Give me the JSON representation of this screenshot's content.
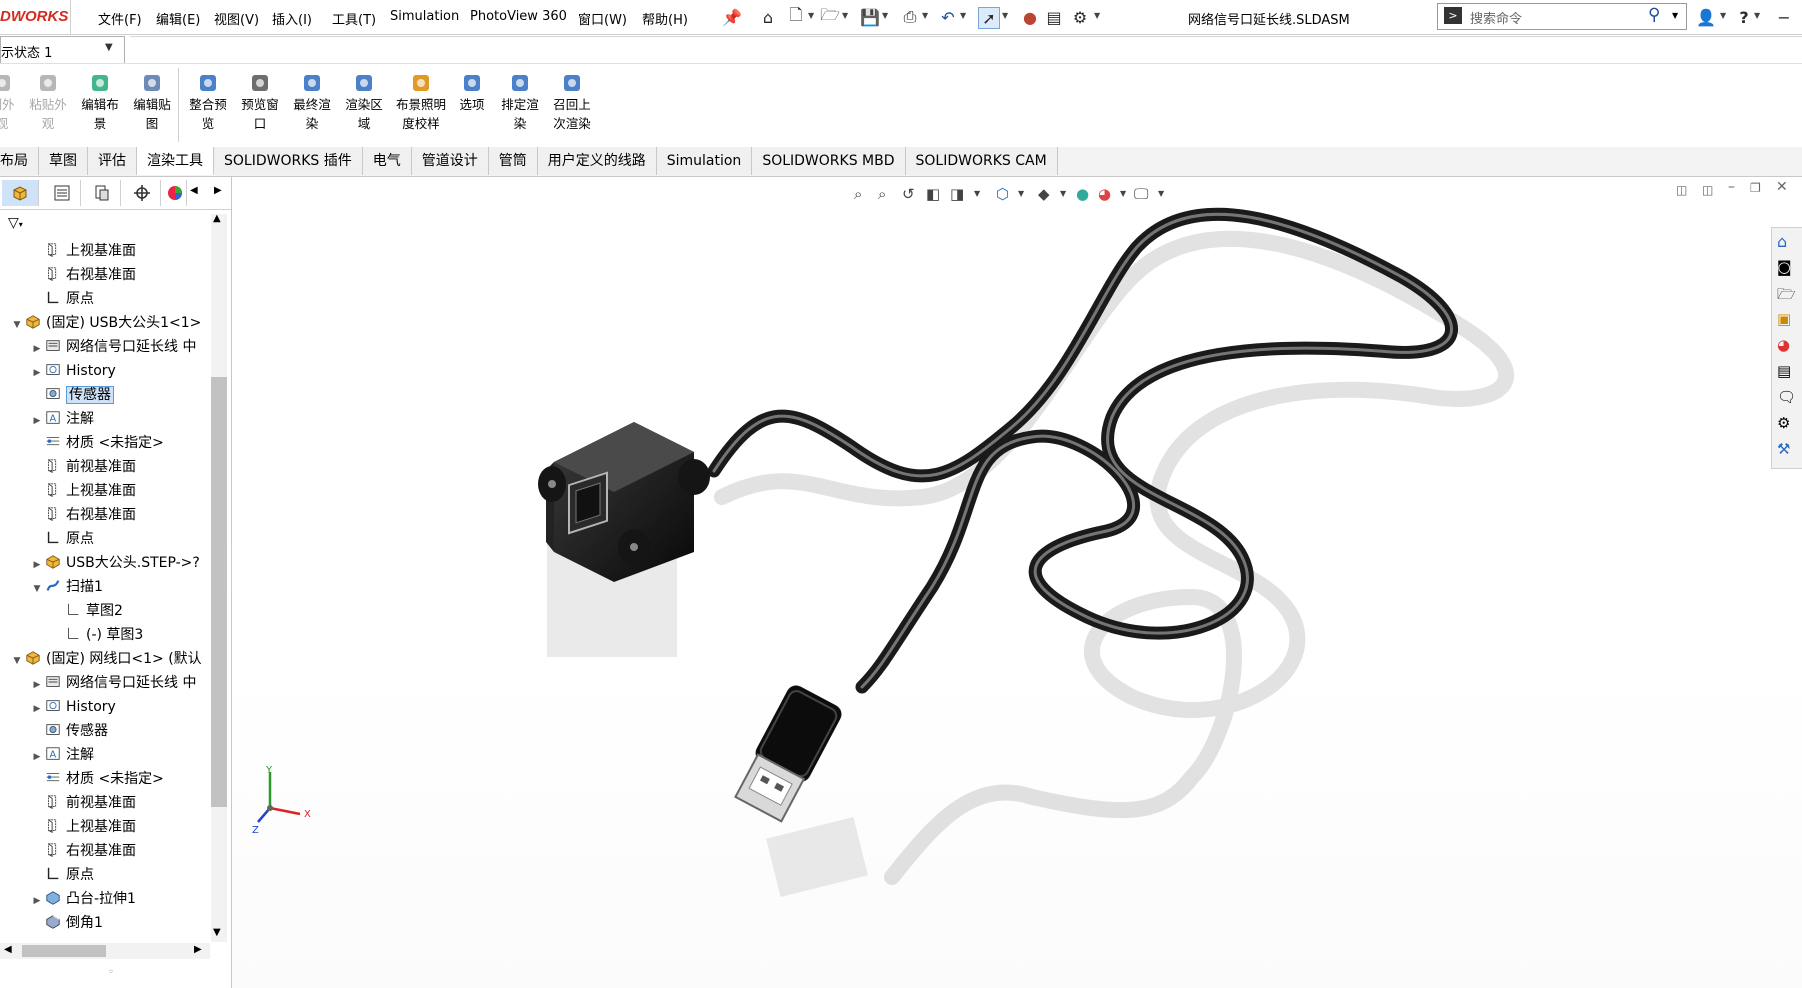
{
  "app": {
    "logo_text": "DWORKS"
  },
  "menubar": {
    "items": [
      "文件(F)",
      "编辑(E)",
      "视图(V)",
      "插入(I)",
      "工具(T)",
      "Simulation",
      "PhotoView 360",
      "窗口(W)",
      "帮助(H)"
    ]
  },
  "title": {
    "filename": "网络信号口延长线.SLDASM"
  },
  "search": {
    "placeholder": "搜索命令"
  },
  "config": {
    "value": "示状态 1"
  },
  "ribbon": {
    "buttons": [
      {
        "label": "制外\n观",
        "disabled": true
      },
      {
        "label": "粘贴外\n观",
        "disabled": true
      },
      {
        "label": "编辑布\n景",
        "disabled": false
      },
      {
        "label": "编辑贴\n图",
        "disabled": false
      },
      {
        "label": "整合预\n览",
        "disabled": false
      },
      {
        "label": "预览窗\n口",
        "disabled": false
      },
      {
        "label": "最终渲\n染",
        "disabled": false
      },
      {
        "label": "渲染区\n域",
        "disabled": false
      },
      {
        "label": "布景照明\n度校样",
        "disabled": false
      },
      {
        "label": "选项",
        "disabled": false
      },
      {
        "label": "排定渲\n染",
        "disabled": false
      },
      {
        "label": "召回上\n次渲染",
        "disabled": false
      }
    ]
  },
  "tabs": [
    "布局",
    "草图",
    "评估",
    "渲染工具",
    "SOLIDWORKS 插件",
    "电气",
    "管道设计",
    "管筒",
    "用户定义的线路",
    "Simulation",
    "SOLIDWORKS MBD",
    "SOLIDWORKS CAM"
  ],
  "active_tab": "渲染工具",
  "tree": [
    {
      "label": "上视基准面",
      "indent": 1,
      "icon": "plane-icon",
      "arrow": ""
    },
    {
      "label": "右视基准面",
      "indent": 1,
      "icon": "plane-icon",
      "arrow": ""
    },
    {
      "label": "原点",
      "indent": 1,
      "icon": "origin-icon",
      "arrow": ""
    },
    {
      "label": "(固定) USB大公头1<1>",
      "indent": 0,
      "icon": "part-icon",
      "arrow": "expanded"
    },
    {
      "label": "网络信号口延长线 中",
      "indent": 1,
      "icon": "assembly-icon",
      "arrow": "collapsed"
    },
    {
      "label": "History",
      "indent": 1,
      "icon": "history-icon",
      "arrow": "collapsed"
    },
    {
      "label": "传感器",
      "indent": 1,
      "icon": "sensor-icon",
      "arrow": "",
      "selected": true
    },
    {
      "label": "注解",
      "indent": 1,
      "icon": "annotation-icon",
      "arrow": "collapsed"
    },
    {
      "label": "材质 <未指定>",
      "indent": 1,
      "icon": "material-icon",
      "arrow": ""
    },
    {
      "label": "前视基准面",
      "indent": 1,
      "icon": "plane-icon",
      "arrow": ""
    },
    {
      "label": "上视基准面",
      "indent": 1,
      "icon": "plane-icon",
      "arrow": ""
    },
    {
      "label": "右视基准面",
      "indent": 1,
      "icon": "plane-icon",
      "arrow": ""
    },
    {
      "label": "原点",
      "indent": 1,
      "icon": "origin-icon",
      "arrow": ""
    },
    {
      "label": "USB大公头.STEP->?",
      "indent": 1,
      "icon": "part-icon",
      "arrow": "collapsed"
    },
    {
      "label": "扫描1",
      "indent": 1,
      "icon": "sweep-icon",
      "arrow": "expanded"
    },
    {
      "label": "草图2",
      "indent": 2,
      "icon": "sketch-icon",
      "arrow": ""
    },
    {
      "label": "(-) 草图3",
      "indent": 2,
      "icon": "sketch-icon",
      "arrow": ""
    },
    {
      "label": "(固定) 网线口<1> (默认",
      "indent": 0,
      "icon": "part-icon",
      "arrow": "expanded"
    },
    {
      "label": "网络信号口延长线 中",
      "indent": 1,
      "icon": "assembly-icon",
      "arrow": "collapsed"
    },
    {
      "label": "History",
      "indent": 1,
      "icon": "history-icon",
      "arrow": "collapsed"
    },
    {
      "label": "传感器",
      "indent": 1,
      "icon": "sensor-icon",
      "arrow": ""
    },
    {
      "label": "注解",
      "indent": 1,
      "icon": "annotation-icon",
      "arrow": "collapsed"
    },
    {
      "label": "材质 <未指定>",
      "indent": 1,
      "icon": "material-icon",
      "arrow": ""
    },
    {
      "label": "前视基准面",
      "indent": 1,
      "icon": "plane-icon",
      "arrow": ""
    },
    {
      "label": "上视基准面",
      "indent": 1,
      "icon": "plane-icon",
      "arrow": ""
    },
    {
      "label": "右视基准面",
      "indent": 1,
      "icon": "plane-icon",
      "arrow": ""
    },
    {
      "label": "原点",
      "indent": 1,
      "icon": "origin-icon",
      "arrow": ""
    },
    {
      "label": "凸台-拉伸1",
      "indent": 1,
      "icon": "extrude-icon",
      "arrow": "collapsed"
    },
    {
      "label": "倒角1",
      "indent": 1,
      "icon": "chamfer-icon",
      "arrow": ""
    }
  ],
  "triad": {
    "x": "X",
    "y": "Y",
    "z": "Z"
  },
  "colors": {
    "accent": "#d52b1e",
    "selection": "#cfe2f7",
    "cable": "#2b2b2b"
  }
}
